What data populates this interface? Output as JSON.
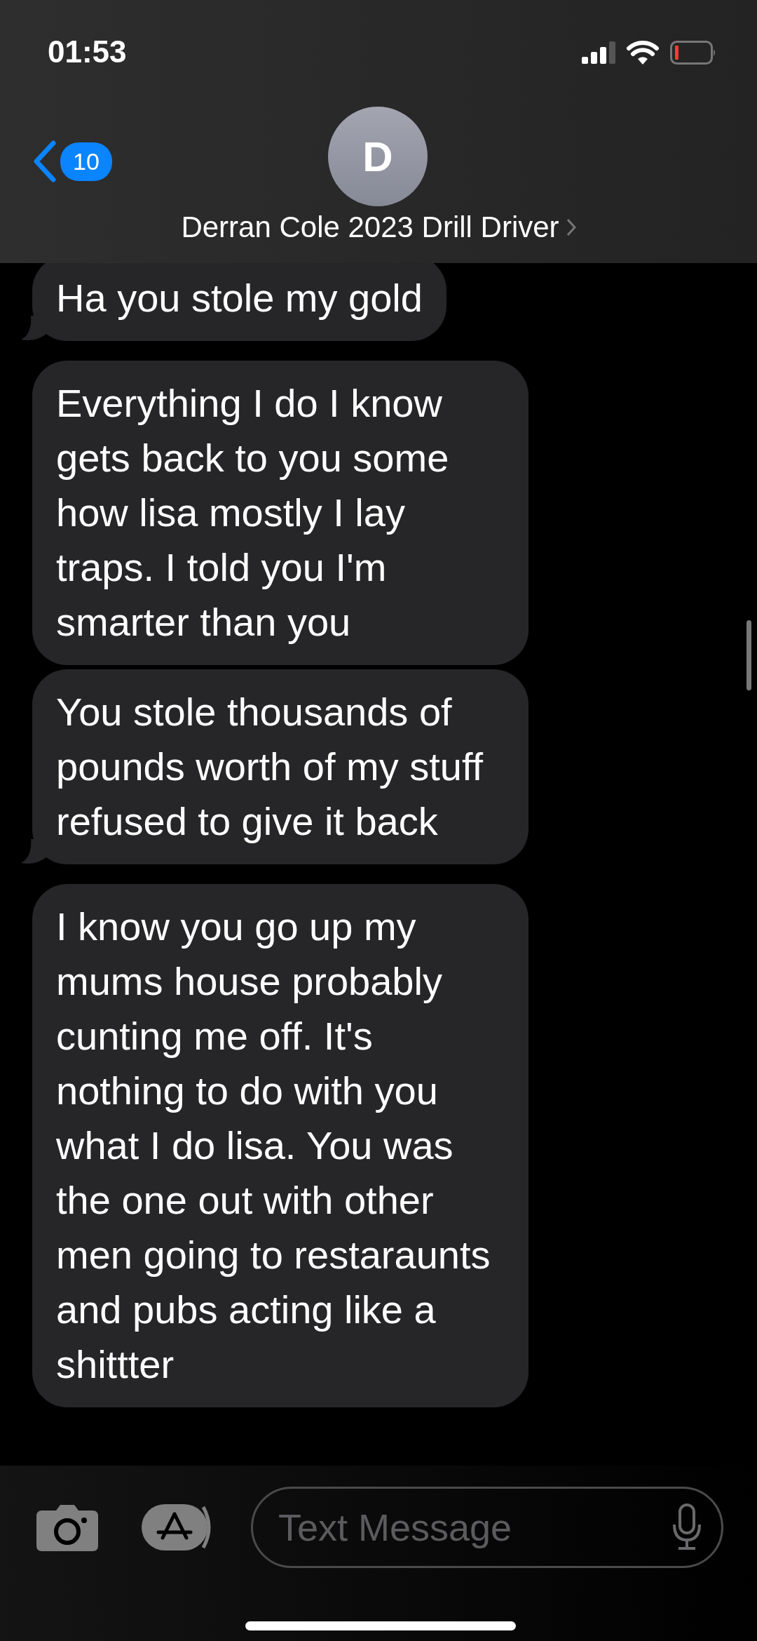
{
  "status_bar": {
    "time": "01:53"
  },
  "header": {
    "back_count": "10",
    "avatar_initial": "D",
    "contact_name": "Derran Cole 2023 Drill Driver"
  },
  "messages": [
    {
      "text": "Ha you stole my gold",
      "tail": true
    },
    {
      "text": "Everything I do I know gets back to you some how lisa mostly I lay traps. I told you I'm smarter than you",
      "tail": false
    },
    {
      "text": "You stole thousands of pounds worth of my stuff refused to give it back",
      "tail": true
    },
    {
      "text": "I know you go up my mums house probably cunting me off. It's nothing to do with you what I do lisa. You was the one out with other men going to restaraunts and pubs acting like a shittter",
      "tail": false
    }
  ],
  "composer": {
    "placeholder": "Text Message"
  }
}
